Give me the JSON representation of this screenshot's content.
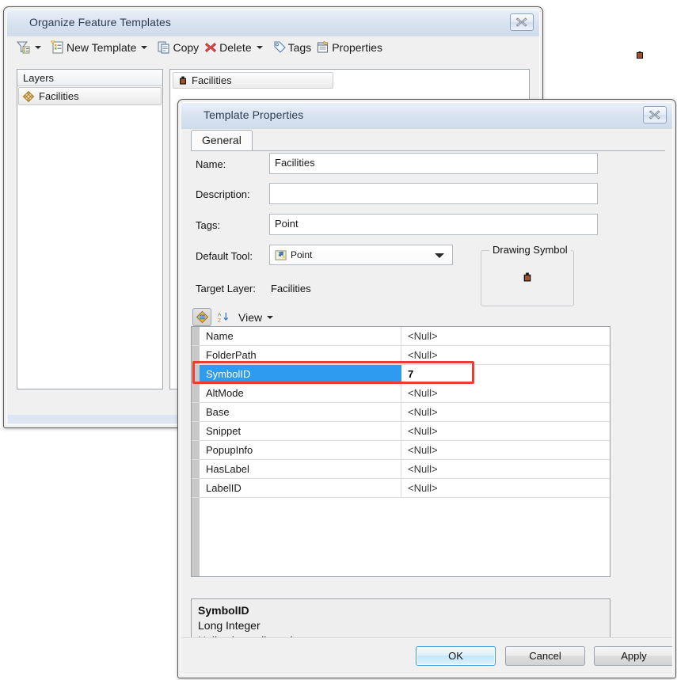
{
  "organize_window": {
    "title": "Organize Feature Templates",
    "close_label": "Close",
    "toolbar": {
      "filter_label": "",
      "new_template_label": "New Template",
      "copy_label": "Copy",
      "delete_label": "Delete",
      "tags_label": "Tags",
      "properties_label": "Properties"
    },
    "layers_panel": {
      "header": "Layers",
      "items": [
        {
          "label": "Facilities",
          "icon": "polygon-layer-icon"
        }
      ]
    },
    "templates_panel": {
      "items": [
        {
          "label": "Facilities",
          "icon": "point-symbol-icon"
        }
      ]
    }
  },
  "template_properties": {
    "title": "Template Properties",
    "close_label": "Close",
    "tabs": [
      {
        "label": "General",
        "selected": true
      }
    ],
    "fields": {
      "name_label": "Name:",
      "name_value": "Facilities",
      "description_label": "Description:",
      "description_value": "",
      "tags_label": "Tags:",
      "tags_value": "Point",
      "default_tool_label": "Default Tool:",
      "default_tool_value": "Point",
      "target_layer_label": "Target Layer:",
      "target_layer_value": "Facilities"
    },
    "drawing_symbol": {
      "title": "Drawing Symbol",
      "symbol_color": "#a0522d"
    },
    "grid_toolbar": {
      "categorize_label": "Categorize",
      "sort_label": "Sort alphabetically",
      "view_label": "View"
    },
    "property_grid": {
      "rows": [
        {
          "name": "Name",
          "value": "<Null>",
          "selected": false
        },
        {
          "name": "FolderPath",
          "value": "<Null>",
          "selected": false
        },
        {
          "name": "SymbolID",
          "value": "7",
          "selected": true
        },
        {
          "name": "AltMode",
          "value": "<Null>",
          "selected": false
        },
        {
          "name": "Base",
          "value": "<Null>",
          "selected": false
        },
        {
          "name": "Snippet",
          "value": "<Null>",
          "selected": false
        },
        {
          "name": "PopupInfo",
          "value": "<Null>",
          "selected": false
        },
        {
          "name": "HasLabel",
          "value": "<Null>",
          "selected": false
        },
        {
          "name": "LabelID",
          "value": "<Null>",
          "selected": false
        }
      ],
      "highlight_color": "#ee3b33",
      "selection_color": "#2f9bf0"
    },
    "description_panel": {
      "title": "SymbolID",
      "line1": "Long Integer",
      "line2": "Null values allowed"
    },
    "buttons": {
      "ok": "OK",
      "cancel": "Cancel",
      "apply": "Apply"
    }
  }
}
